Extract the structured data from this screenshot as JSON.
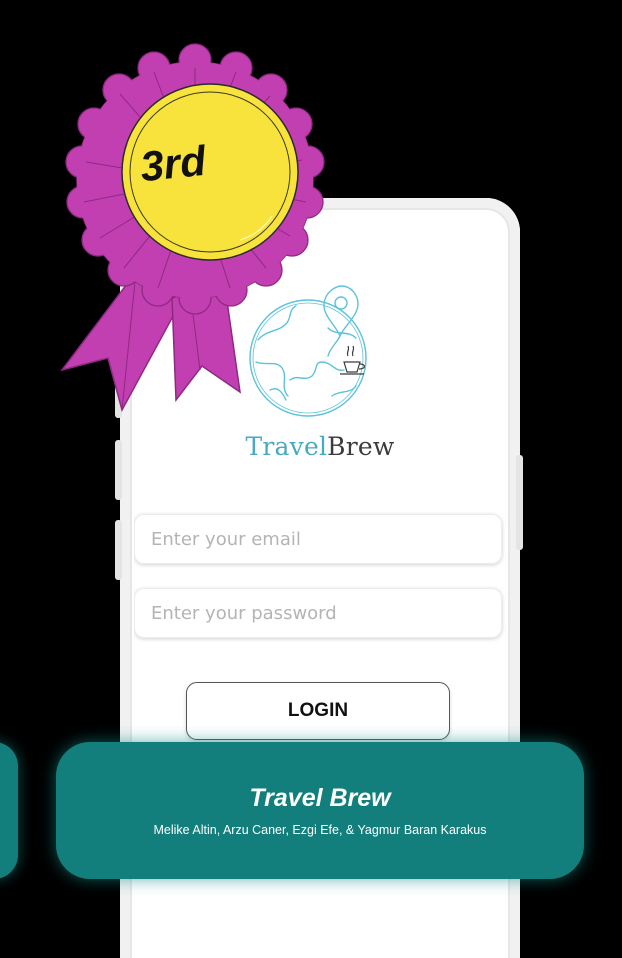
{
  "award": {
    "place": "3rd",
    "colors": {
      "rosette": "#c23fb1",
      "medal": "#f7e33b"
    }
  },
  "app": {
    "brand_part1": "Travel",
    "brand_part2": "Brew",
    "logo_icon": "globe-location-pin-icon",
    "colors": {
      "brand_teal": "#4aa9c2",
      "banner": "#127f7c"
    }
  },
  "login_form": {
    "email_placeholder": "Enter your email",
    "password_placeholder": "Enter your password",
    "login_label": "LOGIN"
  },
  "banner": {
    "title": "Travel Brew",
    "authors": "Melike Altin, Arzu Caner, Ezgi Efe, & Yagmur Baran Karakus"
  }
}
